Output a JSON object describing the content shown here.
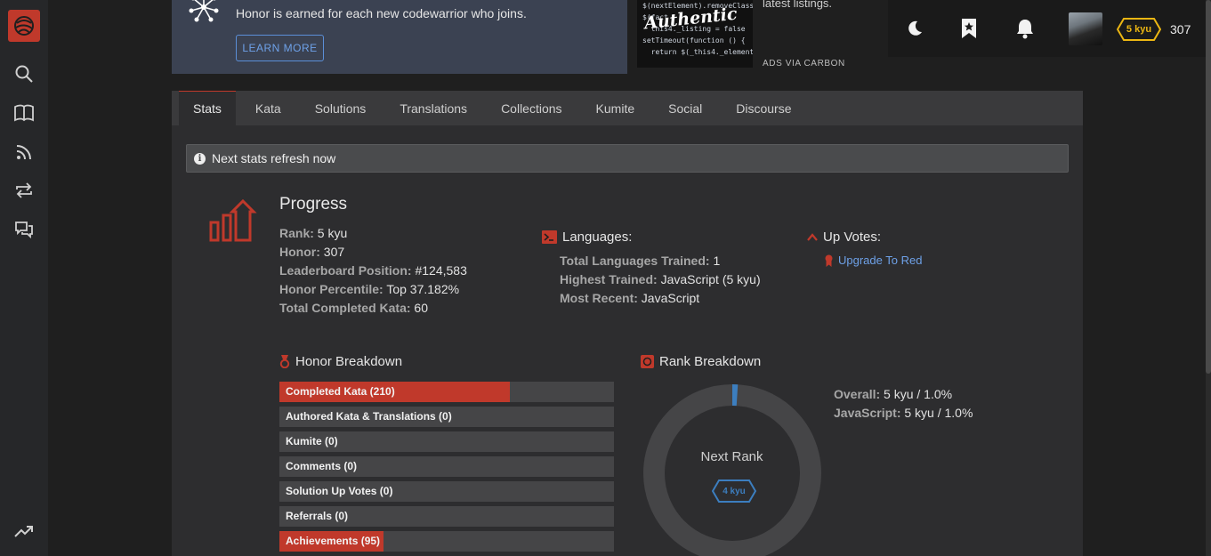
{
  "promo": {
    "text": "Honor is earned for each new codewarrior who joins.",
    "button": "LEARN MORE"
  },
  "ad": {
    "logo_text": "Authentic",
    "code_lines": [
      "$(nextElement).removeClass",
      "$(fact",
      "  this4._listing = false",
      "setTimeout(function () {",
      "  return $(_this4._element"
    ],
    "copy": "latest listings.",
    "via": "ADS VIA CARBON"
  },
  "user": {
    "rank_badge": "5 kyu",
    "honor": "307"
  },
  "tabs": [
    "Stats",
    "Kata",
    "Solutions",
    "Translations",
    "Collections",
    "Kumite",
    "Social",
    "Discourse"
  ],
  "notice": "Next stats refresh now",
  "progress": {
    "title": "Progress",
    "rows": [
      {
        "k": "Rank:",
        "v": "5 kyu"
      },
      {
        "k": "Honor:",
        "v": "307"
      },
      {
        "k": "Leaderboard Position:",
        "v": "#124,583"
      },
      {
        "k": "Honor Percentile:",
        "v": "Top 37.182%"
      },
      {
        "k": "Total Completed Kata:",
        "v": "60"
      }
    ]
  },
  "languages": {
    "title": "Languages:",
    "rows": [
      {
        "k": "Total Languages Trained:",
        "v": "1"
      },
      {
        "k": "Highest Trained:",
        "v": "JavaScript (5 kyu)"
      },
      {
        "k": "Most Recent:",
        "v": "JavaScript"
      }
    ]
  },
  "upvotes": {
    "title": "Up Votes:",
    "link": "Upgrade To Red"
  },
  "honor_breakdown": {
    "title": "Honor Breakdown",
    "bars": [
      {
        "label": "Completed Kata (210)",
        "fill": 0.69
      },
      {
        "label": "Authored Kata & Translations (0)",
        "fill": 0
      },
      {
        "label": "Kumite (0)",
        "fill": 0
      },
      {
        "label": "Comments (0)",
        "fill": 0
      },
      {
        "label": "Solution Up Votes (0)",
        "fill": 0
      },
      {
        "label": "Referrals (0)",
        "fill": 0
      },
      {
        "label": "Achievements (95)",
        "fill": 0.31
      }
    ]
  },
  "rank_breakdown": {
    "title": "Rank Breakdown",
    "progress_fraction": 0.01,
    "next_rank_label": "Next Rank",
    "next_rank_badge": "4 kyu",
    "rows": [
      {
        "k": "Overall:",
        "v": "5 kyu / 1.0%"
      },
      {
        "k": "JavaScript:",
        "v": "5 kyu / 1.0%"
      }
    ]
  },
  "colors": {
    "accent": "#c0392b",
    "link": "#6ea1e8",
    "kyu_yellow": "#ecb613",
    "kyu_blue": "#3c7ebf"
  }
}
